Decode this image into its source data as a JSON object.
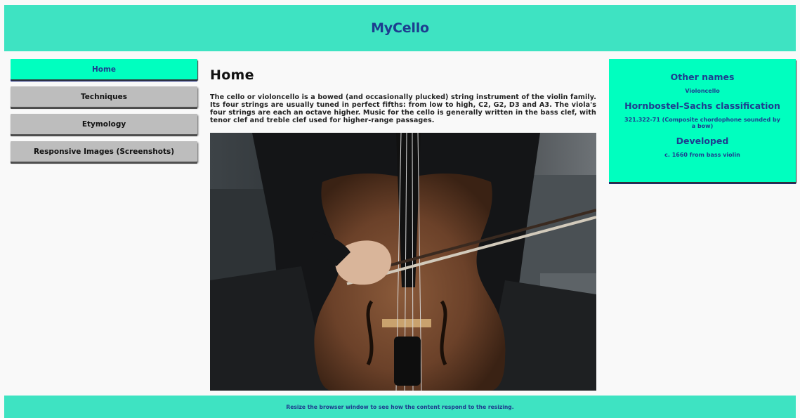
{
  "header": {
    "title": "MyCello"
  },
  "nav": {
    "items": [
      {
        "label": "Home",
        "active": true
      },
      {
        "label": "Techniques",
        "active": false
      },
      {
        "label": "Etymology",
        "active": false
      },
      {
        "label": "Responsive Images (Screenshots)",
        "active": false
      }
    ]
  },
  "main": {
    "title": "Home",
    "text": "The cello or violoncello is a bowed (and occasionally plucked) string instrument of the violin family. Its four strings are usually tuned in perfect fifths: from low to high, C2, G2, D3 and A3. The viola's four strings are each an octave higher. Music for the cello is generally written in the bass clef, with tenor clef and treble clef used for higher-range passages.",
    "image": "cello-photo"
  },
  "aside": {
    "sections": [
      {
        "heading": "Other names",
        "value": "Violoncello"
      },
      {
        "heading": "Hornbostel–Sachs classification",
        "value": "321.322-71 (Composite chordophone sounded by a bow)"
      },
      {
        "heading": "Developed",
        "value": "c. 1660 from bass violin"
      }
    ]
  },
  "footer": {
    "text": "Resize the browser window to see how the content respond to the resizing."
  },
  "colors": {
    "header_bg": "#3ee3c2",
    "accent": "#00ffbf",
    "title_blue": "#1d3d8f",
    "nav_inactive": "#bdbdbd"
  }
}
